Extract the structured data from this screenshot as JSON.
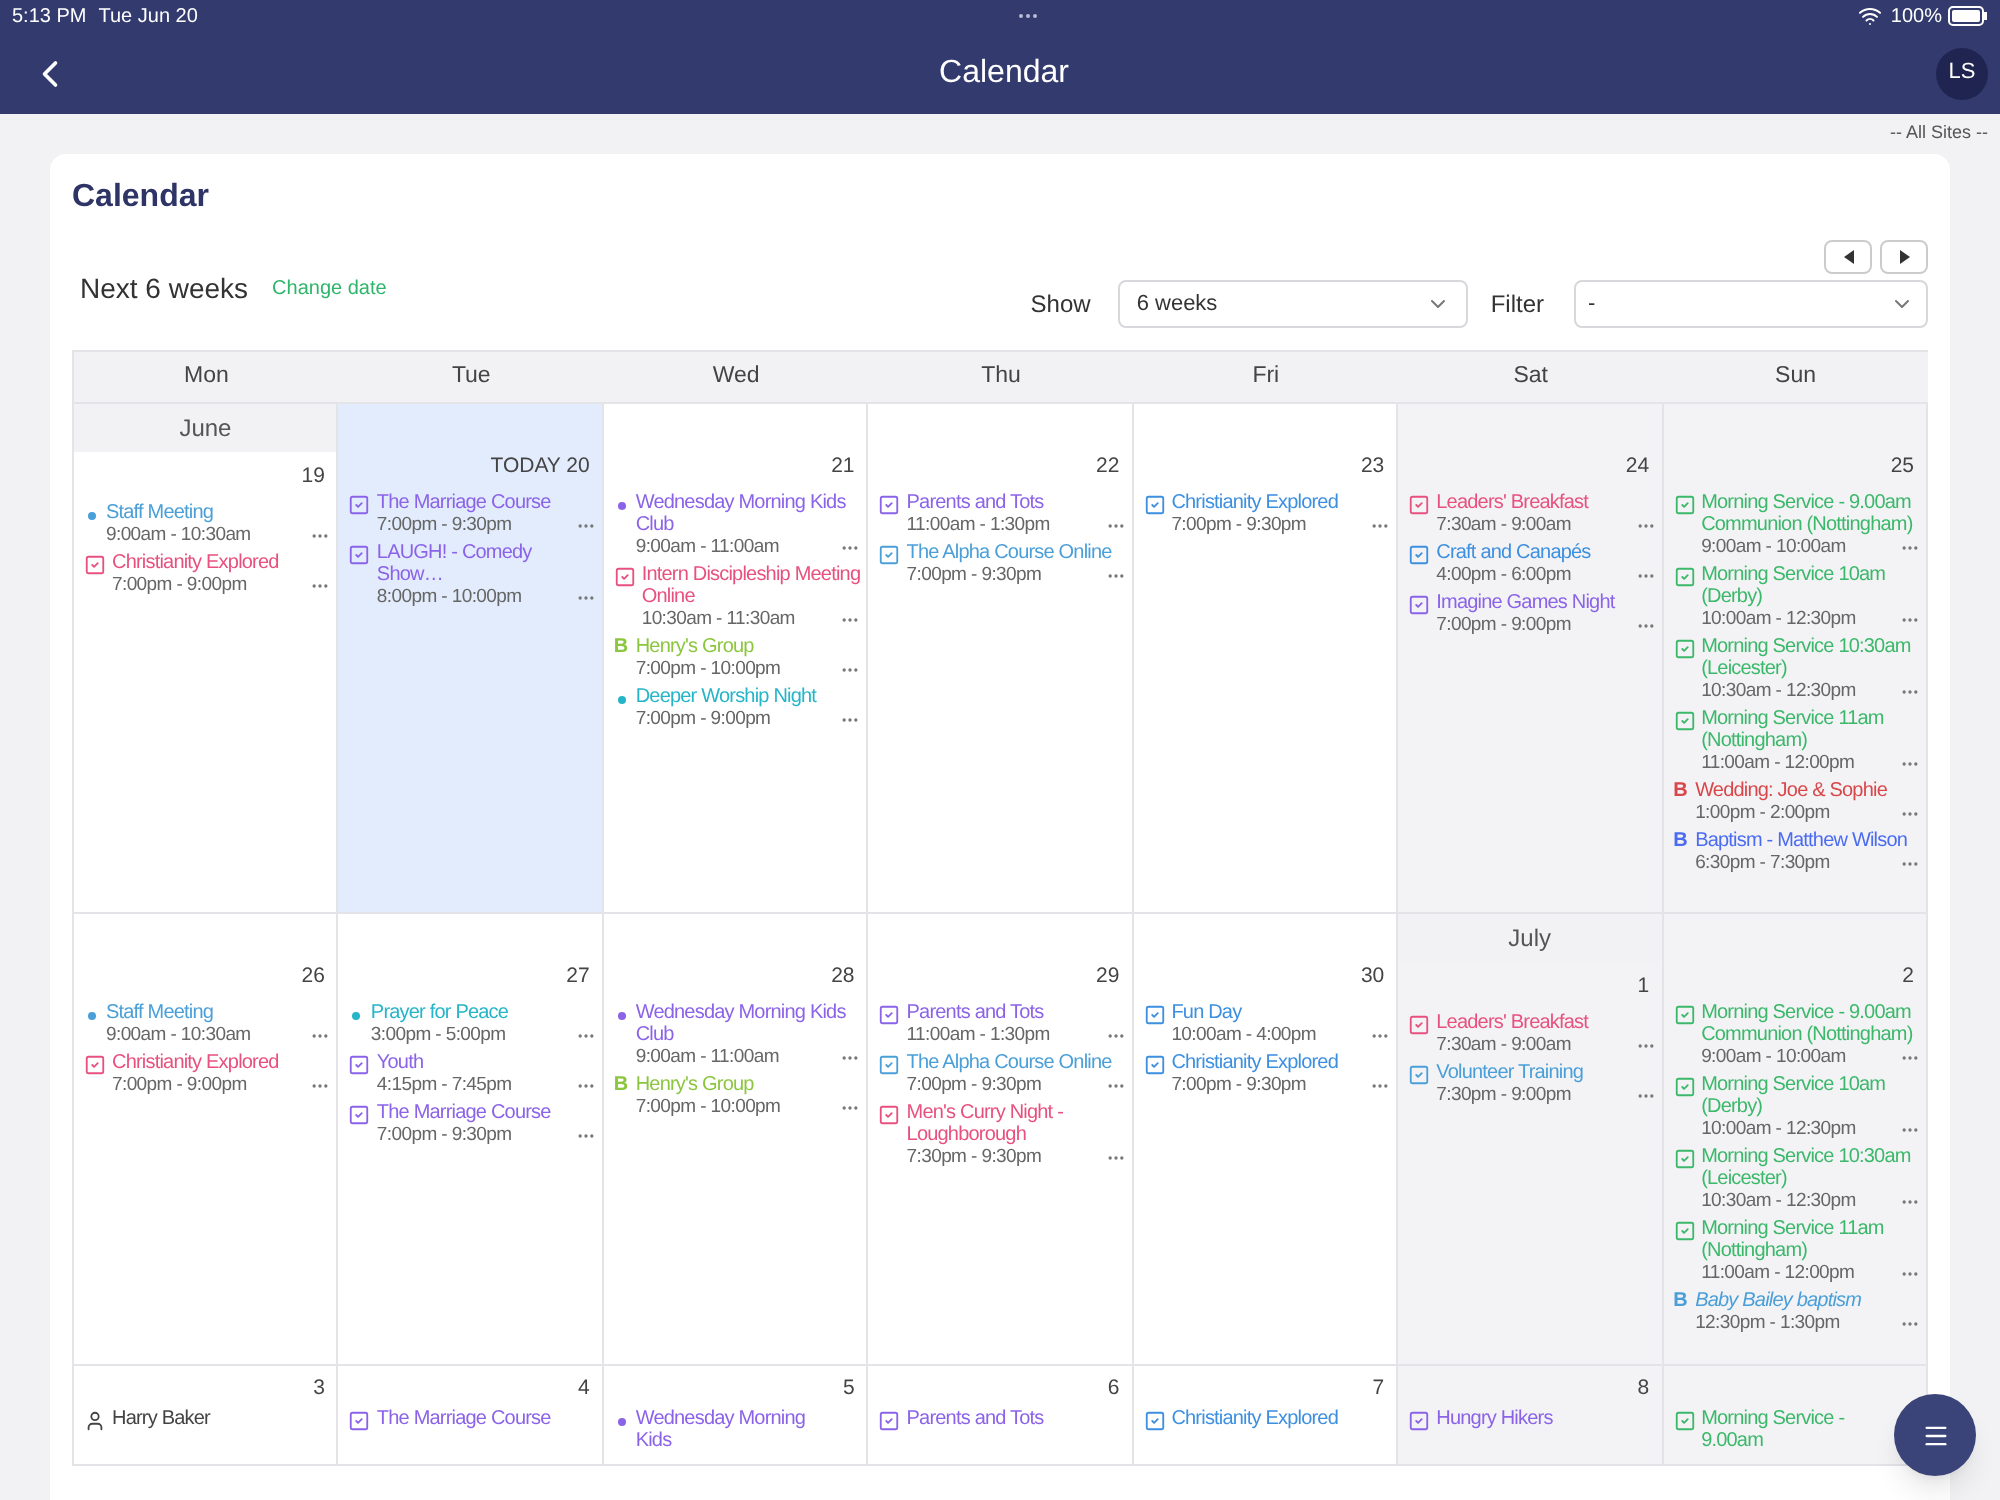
{
  "status_bar": {
    "time": "5:13 PM",
    "date": "Tue Jun 20",
    "battery": "100%"
  },
  "nav_bar": {
    "title": "Calendar",
    "avatar": "LS"
  },
  "site_selector": "-- All Sites --",
  "page_title": "Calendar",
  "range_label": "Next 6 weeks",
  "change_date": "Change date",
  "show": {
    "label": "Show",
    "value": "6 weeks"
  },
  "filter": {
    "label": "Filter",
    "value": "-"
  },
  "weekdays": [
    "Mon",
    "Tue",
    "Wed",
    "Thu",
    "Fri",
    "Sat",
    "Sun"
  ],
  "weeks": [
    {
      "cells": [
        {
          "month": "June",
          "date": "19",
          "today": false,
          "events": [
            {
              "kind": "dot",
              "color": "#4a9fd8",
              "title": "Staff Meeting",
              "time": "9:00am - 10:30am"
            },
            {
              "kind": "check",
              "color": "#e8517f",
              "title": "Christianity Explored",
              "time": "7:00pm - 9:00pm"
            }
          ]
        },
        {
          "date": "TODAY 20",
          "today": true,
          "events": [
            {
              "kind": "check",
              "color": "#8b63e8",
              "title": "The Marriage Course",
              "time": "7:00pm - 9:30pm"
            },
            {
              "kind": "check",
              "color": "#8b63e8",
              "title": "LAUGH! - Comedy Show…",
              "time": "8:00pm - 10:00pm"
            }
          ]
        },
        {
          "date": "21",
          "today": false,
          "events": [
            {
              "kind": "dot",
              "color": "#8b63e8",
              "title": "Wednesday Morning Kids Club",
              "time": "9:00am - 11:00am"
            },
            {
              "kind": "check",
              "color": "#e8517f",
              "title": "Intern Discipleship Meeting Online",
              "time": "10:30am - 11:30am"
            },
            {
              "kind": "letter",
              "badge": "B",
              "color": "#8cc63f",
              "title": "Henry's Group",
              "time": "7:00pm - 10:00pm"
            },
            {
              "kind": "dot",
              "color": "#25b5c8",
              "title": "Deeper Worship Night",
              "time": "7:00pm - 9:00pm"
            }
          ]
        },
        {
          "date": "22",
          "today": false,
          "events": [
            {
              "kind": "check",
              "color": "#8b63e8",
              "title": "Parents and Tots",
              "time": "11:00am - 1:30pm"
            },
            {
              "kind": "check",
              "color": "#4a9fd8",
              "title": "The Alpha Course Online",
              "time": "7:00pm - 9:30pm"
            }
          ]
        },
        {
          "date": "23",
          "today": false,
          "events": [
            {
              "kind": "check",
              "color": "#3d8fe0",
              "title": "Christianity Explored",
              "time": "7:00pm - 9:30pm"
            }
          ]
        },
        {
          "date": "24",
          "today": false,
          "events": [
            {
              "kind": "check",
              "color": "#e8517f",
              "title": "Leaders' Breakfast",
              "time": "7:30am - 9:00am"
            },
            {
              "kind": "check",
              "color": "#3d8fe0",
              "title": "Craft and Canapés",
              "time": "4:00pm - 6:00pm"
            },
            {
              "kind": "check",
              "color": "#8b63e8",
              "title": "Imagine Games Night",
              "time": "7:00pm - 9:00pm"
            }
          ]
        },
        {
          "date": "25",
          "today": false,
          "events": [
            {
              "kind": "check",
              "color": "#3cb86b",
              "title": "Morning Service - 9.00am Communion (Nottingham)",
              "time": "9:00am - 10:00am"
            },
            {
              "kind": "check",
              "color": "#3cb86b",
              "title": "Morning Service 10am (Derby)",
              "time": "10:00am - 12:30pm"
            },
            {
              "kind": "check",
              "color": "#3cb86b",
              "title": "Morning Service 10:30am (Leicester)",
              "time": "10:30am - 12:30pm"
            },
            {
              "kind": "check",
              "color": "#3cb86b",
              "title": "Morning Service 11am (Nottingham)",
              "time": "11:00am - 12:00pm"
            },
            {
              "kind": "letter",
              "badge": "B",
              "color": "#d9474a",
              "title": "Wedding: Joe & Sophie",
              "time": "1:00pm - 2:00pm"
            },
            {
              "kind": "letter",
              "badge": "B",
              "color": "#4b6cf0",
              "title": "Baptism - Matthew Wilson",
              "time": "6:30pm - 7:30pm"
            }
          ]
        }
      ]
    },
    {
      "cells": [
        {
          "date": "26",
          "today": false,
          "events": [
            {
              "kind": "dot",
              "color": "#4a9fd8",
              "title": "Staff Meeting",
              "time": "9:00am - 10:30am"
            },
            {
              "kind": "check",
              "color": "#e8517f",
              "title": "Christianity Explored",
              "time": "7:00pm - 9:00pm"
            }
          ]
        },
        {
          "date": "27",
          "today": false,
          "events": [
            {
              "kind": "dot",
              "color": "#25b5c8",
              "title": "Prayer for Peace",
              "time": "3:00pm - 5:00pm"
            },
            {
              "kind": "check",
              "color": "#8b63e8",
              "title": "Youth",
              "time": "4:15pm - 7:45pm"
            },
            {
              "kind": "check",
              "color": "#8b63e8",
              "title": "The Marriage Course",
              "time": "7:00pm - 9:30pm"
            }
          ]
        },
        {
          "date": "28",
          "today": false,
          "events": [
            {
              "kind": "dot",
              "color": "#8b63e8",
              "title": "Wednesday Morning Kids Club",
              "time": "9:00am - 11:00am"
            },
            {
              "kind": "letter",
              "badge": "B",
              "color": "#8cc63f",
              "title": "Henry's Group",
              "time": "7:00pm - 10:00pm"
            }
          ]
        },
        {
          "date": "29",
          "today": false,
          "events": [
            {
              "kind": "check",
              "color": "#8b63e8",
              "title": "Parents and Tots",
              "time": "11:00am - 1:30pm"
            },
            {
              "kind": "check",
              "color": "#4a9fd8",
              "title": "The Alpha Course Online",
              "time": "7:00pm - 9:30pm"
            },
            {
              "kind": "check",
              "color": "#e8517f",
              "title": "Men's Curry Night - Loughborough",
              "time": "7:30pm - 9:30pm"
            }
          ]
        },
        {
          "date": "30",
          "today": false,
          "events": [
            {
              "kind": "check",
              "color": "#3d8fe0",
              "title": "Fun Day",
              "time": "10:00am - 4:00pm"
            },
            {
              "kind": "check",
              "color": "#3d8fe0",
              "title": "Christianity Explored",
              "time": "7:00pm - 9:30pm"
            }
          ]
        },
        {
          "month": "July",
          "date": "1",
          "today": false,
          "events": [
            {
              "kind": "check",
              "color": "#e8517f",
              "title": "Leaders' Breakfast",
              "time": "7:30am - 9:00am"
            },
            {
              "kind": "check",
              "color": "#4a9fd8",
              "title": "Volunteer Training",
              "time": "7:30pm - 9:00pm"
            }
          ]
        },
        {
          "date": "2",
          "today": false,
          "events": [
            {
              "kind": "check",
              "color": "#3cb86b",
              "title": "Morning Service - 9.00am Communion (Nottingham)",
              "time": "9:00am - 10:00am"
            },
            {
              "kind": "check",
              "color": "#3cb86b",
              "title": "Morning Service 10am (Derby)",
              "time": "10:00am - 12:30pm"
            },
            {
              "kind": "check",
              "color": "#3cb86b",
              "title": "Morning Service 10:30am (Leicester)",
              "time": "10:30am - 12:30pm"
            },
            {
              "kind": "check",
              "color": "#3cb86b",
              "title": "Morning Service 11am (Nottingham)",
              "time": "11:00am - 12:00pm"
            },
            {
              "kind": "letter",
              "badge": "B",
              "color": "#4a9fd8",
              "italic": true,
              "title": "Baby Bailey baptism",
              "time": "12:30pm - 1:30pm"
            }
          ]
        }
      ]
    },
    {
      "cells": [
        {
          "date": "3",
          "today": false,
          "events": [
            {
              "kind": "person",
              "color": "#444444",
              "title": "Harry Baker"
            }
          ]
        },
        {
          "date": "4",
          "today": false,
          "events": [
            {
              "kind": "check",
              "color": "#8b63e8",
              "title": "The Marriage Course"
            }
          ]
        },
        {
          "date": "5",
          "today": false,
          "events": [
            {
              "kind": "dot",
              "color": "#8b63e8",
              "title": "Wednesday Morning Kids"
            }
          ]
        },
        {
          "date": "6",
          "today": false,
          "events": [
            {
              "kind": "check",
              "color": "#8b63e8",
              "title": "Parents and Tots"
            }
          ]
        },
        {
          "date": "7",
          "today": false,
          "events": [
            {
              "kind": "check",
              "color": "#3d8fe0",
              "title": "Christianity Explored"
            }
          ]
        },
        {
          "date": "8",
          "today": false,
          "events": [
            {
              "kind": "check",
              "color": "#8b63e8",
              "title": "Hungry Hikers"
            }
          ]
        },
        {
          "today": false,
          "events": [
            {
              "kind": "check",
              "color": "#3cb86b",
              "title": "Morning Service - 9.00am"
            }
          ]
        }
      ]
    }
  ]
}
